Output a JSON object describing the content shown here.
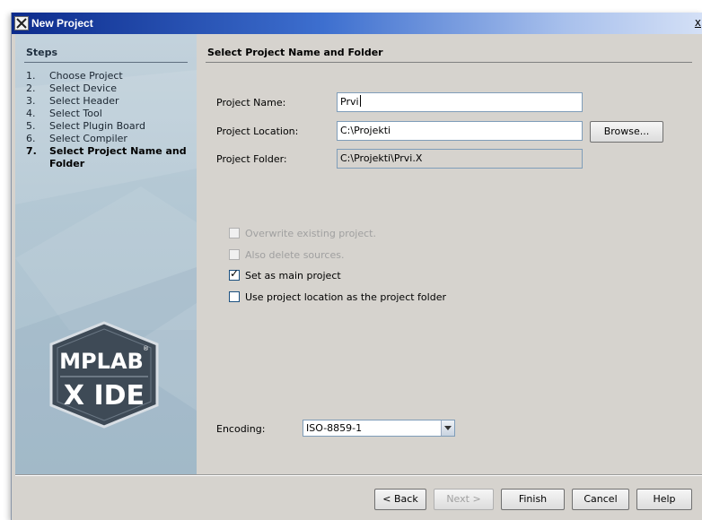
{
  "window": {
    "title": "New Project",
    "close_glyph": "x"
  },
  "steps": {
    "title": "Steps",
    "items": [
      {
        "num": "1.",
        "label": "Choose Project"
      },
      {
        "num": "2.",
        "label": "Select Device"
      },
      {
        "num": "3.",
        "label": "Select Header"
      },
      {
        "num": "4.",
        "label": "Select Tool"
      },
      {
        "num": "5.",
        "label": "Select Plugin Board"
      },
      {
        "num": "6.",
        "label": "Select Compiler"
      },
      {
        "num": "7.",
        "label": "Select Project Name and Folder"
      }
    ],
    "current_index": 6
  },
  "logo": {
    "line1": "MPLAB",
    "registered": "®",
    "line2": "X IDE"
  },
  "page": {
    "title": "Select Project Name and Folder",
    "project_name": {
      "label": "Project Name:",
      "value": "Prvi"
    },
    "project_location": {
      "label": "Project Location:",
      "value": "C:\\Projekti",
      "browse": "Browse..."
    },
    "project_folder": {
      "label": "Project Folder:",
      "value": "C:\\Projekti\\Prvi.X"
    },
    "checkboxes": [
      {
        "label": "Overwrite existing project.",
        "checked": false,
        "enabled": false
      },
      {
        "label": "Also delete sources.",
        "checked": false,
        "enabled": false
      },
      {
        "label": "Set as main project",
        "checked": true,
        "enabled": true
      },
      {
        "label": "Use project location as the project folder",
        "checked": false,
        "enabled": true
      }
    ],
    "encoding": {
      "label": "Encoding:",
      "value": "ISO-8859-1"
    }
  },
  "buttons": {
    "back": "< Back",
    "next": "Next >",
    "finish": "Finish",
    "cancel": "Cancel",
    "help": "Help"
  },
  "colors": {
    "titlebar_start": "#0c2b8c",
    "titlebar_end": "#d4e0f6",
    "dialog_bg": "#d6d3ce",
    "steps_panel": "#b4c8d4",
    "logo_badge": "#3e4a56"
  }
}
